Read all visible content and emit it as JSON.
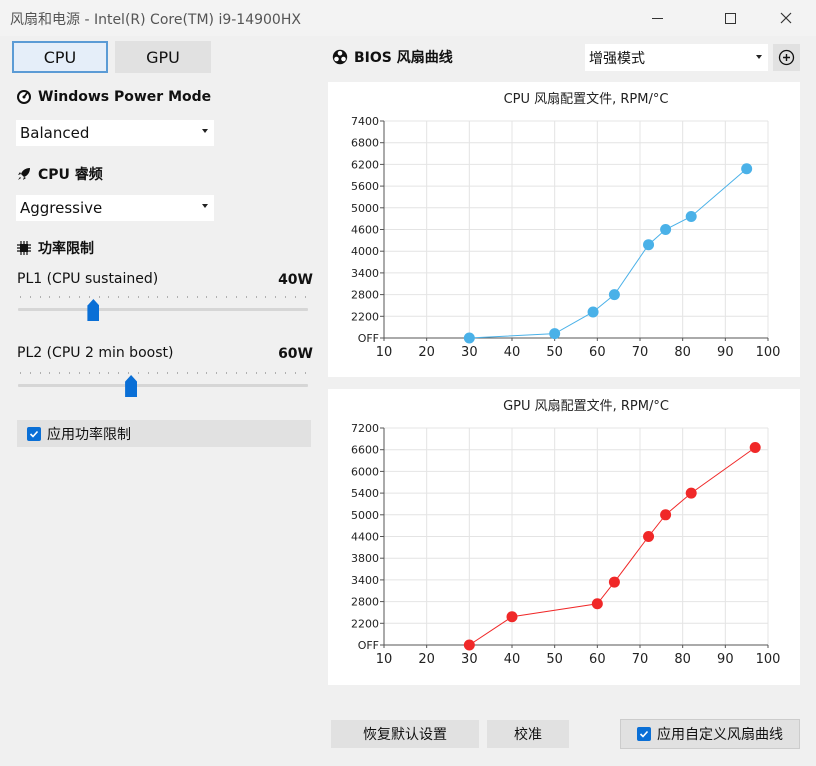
{
  "window": {
    "title": "风扇和电源 - Intel(R) Core(TM) i9-14900HX"
  },
  "tabs": [
    {
      "label": "CPU",
      "active": true
    },
    {
      "label": "GPU",
      "active": false
    }
  ],
  "power_mode": {
    "heading": "Windows Power Mode",
    "selected": "Balanced"
  },
  "cpu_boost": {
    "heading": "CPU 睿频",
    "selected": "Aggressive"
  },
  "power_limit": {
    "heading": "功率限制",
    "pl1": {
      "label": "PL1 (CPU sustained)",
      "value": "40W",
      "fraction": 0.26
    },
    "pl2": {
      "label": "PL2 (CPU 2 min boost)",
      "value": "60W",
      "fraction": 0.39
    },
    "apply_label": "应用功率限制",
    "apply_checked": true
  },
  "fan_curve": {
    "heading": "BIOS 风扇曲线",
    "mode_selected": "增强模式"
  },
  "buttons": {
    "reset": "恢复默认设置",
    "calibrate": "校准",
    "apply_curve": "应用自定义风扇曲线",
    "apply_curve_checked": true
  },
  "chart_data": [
    {
      "type": "line",
      "title": "CPU 风扇配置文件, RPM/°C",
      "color": "#4ab1e8",
      "x_ticks": [
        10,
        20,
        30,
        40,
        50,
        60,
        70,
        80,
        90,
        100
      ],
      "y_ticks": [
        "OFF",
        "2200",
        "2800",
        "3400",
        "4000",
        "4600",
        "5000",
        "5600",
        "6200",
        "6800",
        "7400"
      ],
      "xlim": [
        10,
        100
      ],
      "ylim": [
        0,
        10
      ],
      "points_x": [
        30,
        50,
        59,
        64,
        72,
        76,
        82,
        95
      ],
      "points_y": [
        0,
        0.2,
        1.2,
        2.0,
        4.3,
        5.0,
        5.6,
        7.8
      ]
    },
    {
      "type": "line",
      "title": "GPU 风扇配置文件, RPM/°C",
      "color": "#f02828",
      "x_ticks": [
        10,
        20,
        30,
        40,
        50,
        60,
        70,
        80,
        90,
        100
      ],
      "y_ticks": [
        "OFF",
        "2200",
        "2800",
        "3400",
        "3800",
        "4400",
        "5000",
        "5400",
        "6000",
        "6600",
        "7200"
      ],
      "xlim": [
        10,
        100
      ],
      "ylim": [
        0,
        10
      ],
      "points_x": [
        30,
        40,
        60,
        64,
        72,
        76,
        82,
        97
      ],
      "points_y": [
        0,
        1.3,
        1.9,
        2.9,
        5.0,
        6.0,
        7.0,
        9.1
      ]
    }
  ]
}
